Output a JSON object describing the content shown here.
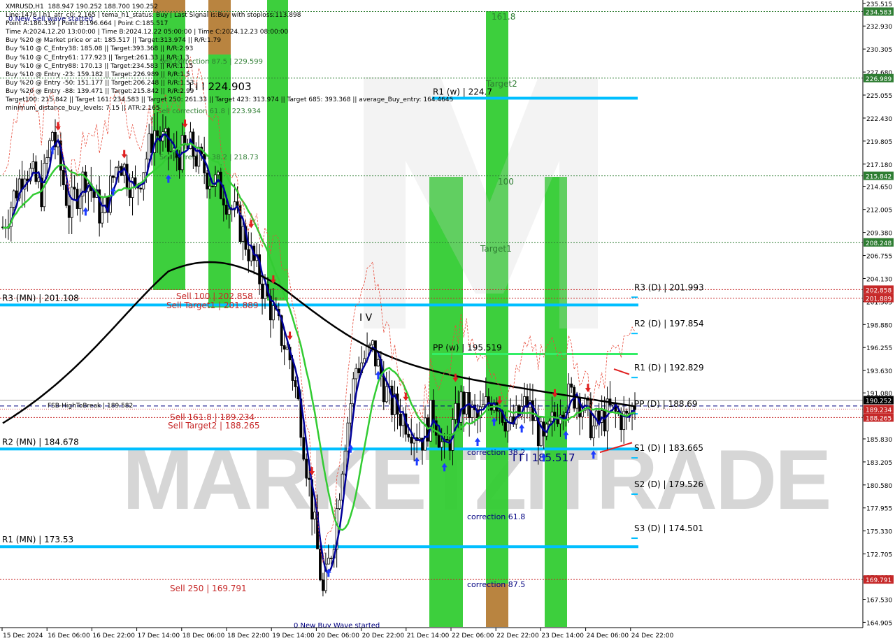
{
  "chart_data": {
    "type": "candlestick",
    "symbol": "XMRUSD,H1",
    "ohlc_header": "188.947 190.252 188.700 190.252",
    "info_lines": [
      "Line:1476 | h1_atr_c0: 2.165 | tema_h1_status: Buy | Last Signal is:Buy with stoploss:113.898",
      "Point A:186.339 | Point B:196.664 | Point C:185.517",
      "Time A:2024.12.20 13:00:00 | Time B:2024.12.22 05:00:00 | Time C:2024.12.23 08:00:00",
      "Buy %20 @ Market price or at: 185.517 || Target:313.974 || R/R:1.79",
      "Buy %10 @ C_Entry38: 185.08 || Target:393.368 || R/R:2.93",
      "Buy %10 @ C_Entry61: 177.923 || Target:261.33 || R/R:1.3",
      "Buy %10 @ C_Entry88: 170.13 || Target:234.583 || R/R:1.15",
      "Buy %10 @ Entry -23: 159.182 || Target:226.989 || R/R:1.5",
      "Buy %20 @ Entry -50: 151.177 || Target:206.248 || R/R:1.53",
      "Buy %20 @ Entry -88: 139.471 || Target:215.842 || R/R:2.99",
      "Target100: 215.842 || Target 161: 234.583 || Target 250: 261.33 || Target 423: 313.974 || Target 685: 393.368 || average_Buy_entry: 164.4645",
      "minimum_distance_buy_levels: 7.15 || ATR:2.165"
    ],
    "y_axis": {
      "ylim": [
        164.3,
        235.9
      ],
      "ticks": [
        "235.515",
        "232.930",
        "230.305",
        "227.680",
        "225.055",
        "222.430",
        "219.805",
        "217.180",
        "214.650",
        "212.005",
        "209.380",
        "206.755",
        "204.130",
        "201.505",
        "198.880",
        "196.255",
        "193.630",
        "191.080",
        "188.455",
        "185.830",
        "183.205",
        "180.580",
        "177.955",
        "175.330",
        "172.705",
        "170.080",
        "167.530",
        "164.905"
      ]
    },
    "x_axis": {
      "labels": [
        "15 Dec 2024",
        "16 Dec 06:00",
        "16 Dec 22:00",
        "17 Dec 14:00",
        "18 Dec 06:00",
        "18 Dec 22:00",
        "19 Dec 14:00",
        "20 Dec 06:00",
        "20 Dec 22:00",
        "21 Dec 14:00",
        "22 Dec 06:00",
        "22 Dec 22:00",
        "23 Dec 14:00",
        "24 Dec 06:00",
        "24 Dec 22:00"
      ]
    },
    "price_tags": [
      {
        "text": "234.583",
        "value": 234.583,
        "color": "#2e7d32"
      },
      {
        "text": "226.989",
        "value": 226.989,
        "color": "#2e7d32"
      },
      {
        "text": "215.842",
        "value": 215.842,
        "color": "#2e7d32"
      },
      {
        "text": "208.248",
        "value": 208.248,
        "color": "#2e7d32"
      },
      {
        "text": "202.858",
        "value": 202.858,
        "color": "#c62828"
      },
      {
        "text": "201.889",
        "value": 201.889,
        "color": "#c62828"
      },
      {
        "text": "190.252",
        "value": 190.252,
        "color": "#000000"
      },
      {
        "text": "189.234",
        "value": 189.234,
        "color": "#c62828"
      },
      {
        "text": "188.265",
        "value": 188.265,
        "color": "#c62828"
      },
      {
        "text": "169.791",
        "value": 169.791,
        "color": "#c62828"
      }
    ],
    "levels": [
      {
        "label": "R3 (MN) | 201.108",
        "value": 201.108,
        "kind": "monthly"
      },
      {
        "label": "R2 (MN) | 184.678",
        "value": 184.678,
        "kind": "monthly"
      },
      {
        "label": "R1 (MN) | 173.53",
        "value": 173.53,
        "kind": "monthly"
      },
      {
        "label": "R1 (w) | 224.7",
        "value": 224.7,
        "kind": "weekly"
      },
      {
        "label": "PP (w) | 195.519",
        "value": 195.519,
        "kind": "weekly-green"
      },
      {
        "label": "R3 (D) | 201.993",
        "value": 201.993,
        "kind": "daily"
      },
      {
        "label": "R2 (D) | 197.854",
        "value": 197.854,
        "kind": "daily"
      },
      {
        "label": "R1 (D) | 192.829",
        "value": 192.829,
        "kind": "daily"
      },
      {
        "label": "PP (D) | 188.69",
        "value": 188.69,
        "kind": "daily"
      },
      {
        "label": "S1 (D) | 183.665",
        "value": 183.665,
        "kind": "daily"
      },
      {
        "label": "S2 (D) | 179.526",
        "value": 179.526,
        "kind": "daily"
      },
      {
        "label": "S3 (D) | 174.501",
        "value": 174.501,
        "kind": "daily"
      }
    ],
    "annotations": [
      {
        "text": "0 New Sell wave started",
        "color": "#000080"
      },
      {
        "text": "Sell correction 87.5 | 229.599",
        "color": "#2e7d32"
      },
      {
        "text": "I I I 224.903",
        "color": "#000000"
      },
      {
        "text": "Sell correction 61.8 | 223.934",
        "color": "#2e7d32"
      },
      {
        "text": "Sell correction 38.2 | 218.73",
        "color": "#2e7d32"
      },
      {
        "text": "Sell 100 | 202.858",
        "color": "#c62828"
      },
      {
        "text": "Sell Target1 | 201.889",
        "color": "#c62828"
      },
      {
        "text": "FSB-HighToBreak | 189.582",
        "color": "#000000"
      },
      {
        "text": "Sell 161.8 | 189.234",
        "color": "#c62828"
      },
      {
        "text": "Sell Target2 | 188.265",
        "color": "#c62828"
      },
      {
        "text": "Sell 250 | 169.791",
        "color": "#c62828"
      },
      {
        "text": "0 New Buy Wave started",
        "color": "#000080"
      },
      {
        "text": "I V",
        "color": "#000000"
      },
      {
        "text": "161.8",
        "color": "#2e7d32"
      },
      {
        "text": "Target2",
        "color": "#2e7d32"
      },
      {
        "text": "100",
        "color": "#2e7d32"
      },
      {
        "text": "Target1",
        "color": "#2e7d32"
      },
      {
        "text": "correction 38.2",
        "color": "#000080"
      },
      {
        "text": "I I I 185.517",
        "color": "#000080"
      },
      {
        "text": "correction 61.8",
        "color": "#000080"
      },
      {
        "text": "correction 87.5",
        "color": "#000080"
      }
    ],
    "watermark": "MARKETZITRADE",
    "grid": false,
    "colors": {
      "level_line": "#00bfff",
      "green_zone": "#33cc33",
      "brown_zone": "#c08040",
      "tema_blue": "#000099",
      "ma_green": "#33cc33",
      "ma_black": "#000000",
      "dashed_red": "#c62828"
    }
  }
}
